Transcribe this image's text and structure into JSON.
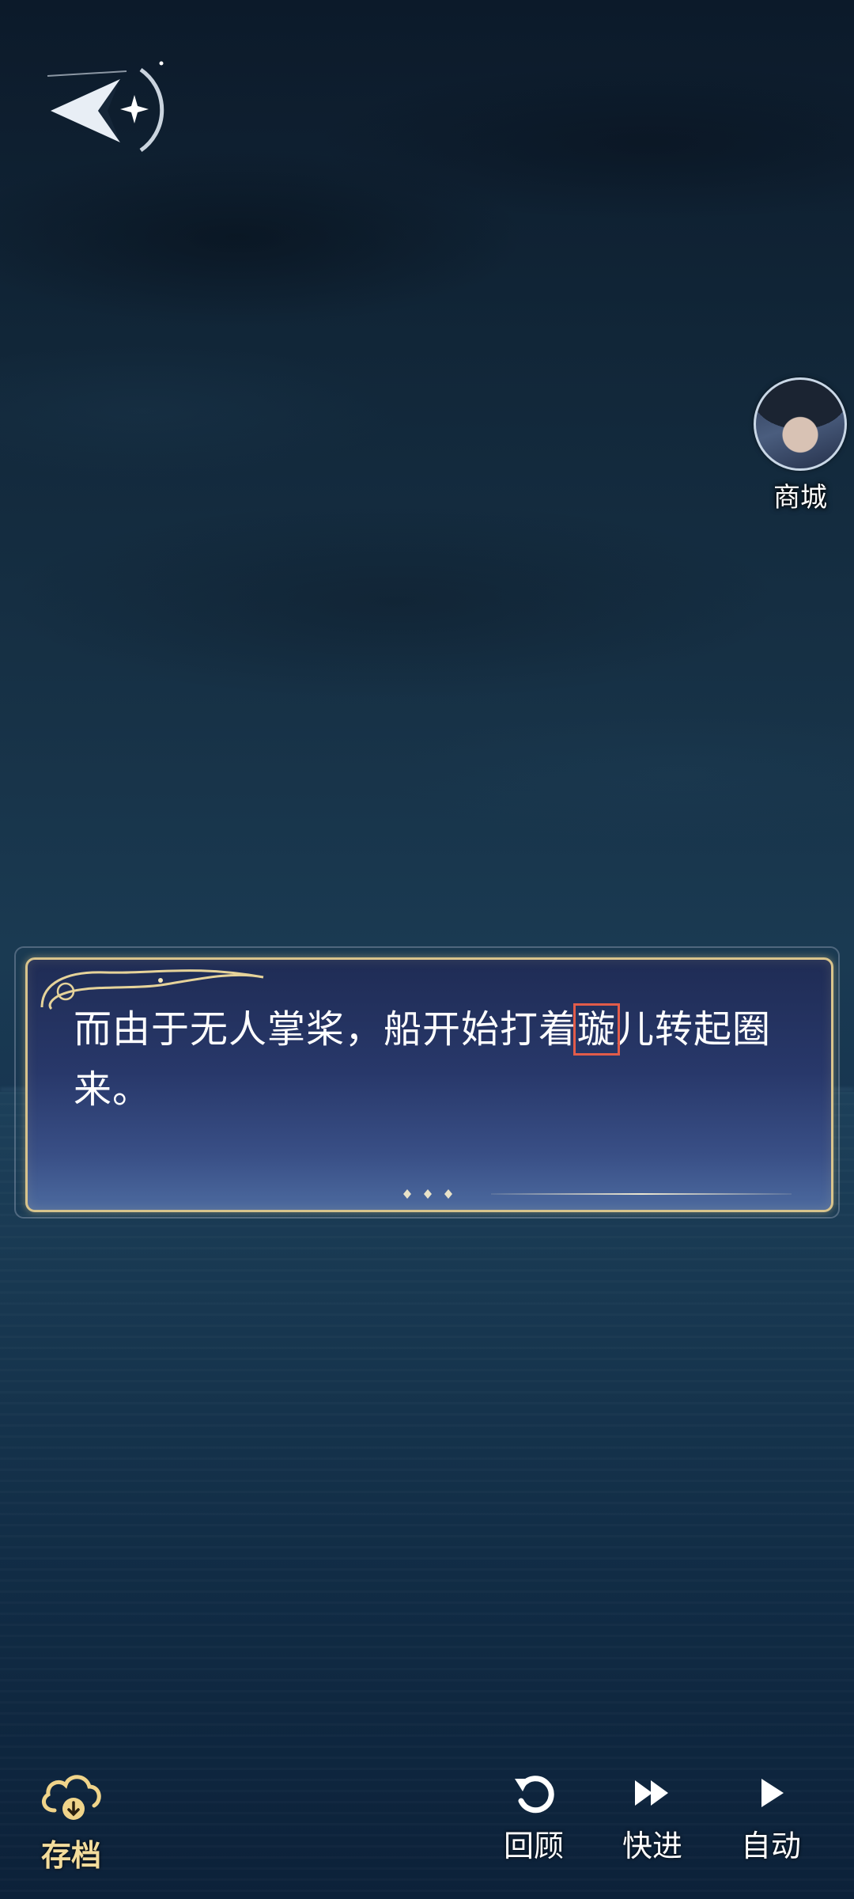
{
  "top": {
    "back_icon": "back-arrow-icon"
  },
  "shop": {
    "label": "商城",
    "avatar": "character-avatar"
  },
  "dialogue": {
    "before": "而由于无人掌桨，船开始打着",
    "highlight": "璇",
    "after": "儿转起圈来。",
    "highlight_color": "#e25c4a"
  },
  "bottom_bar": {
    "save": {
      "label": "存档",
      "icon": "cloud-download-icon"
    },
    "review": {
      "label": "回顾",
      "icon": "rewind-icon"
    },
    "fast_forward": {
      "label": "快进",
      "icon": "fast-forward-icon"
    },
    "auto": {
      "label": "自动",
      "icon": "play-icon"
    }
  },
  "colors": {
    "gold": "#d9c48c",
    "panel": "#28386a"
  }
}
